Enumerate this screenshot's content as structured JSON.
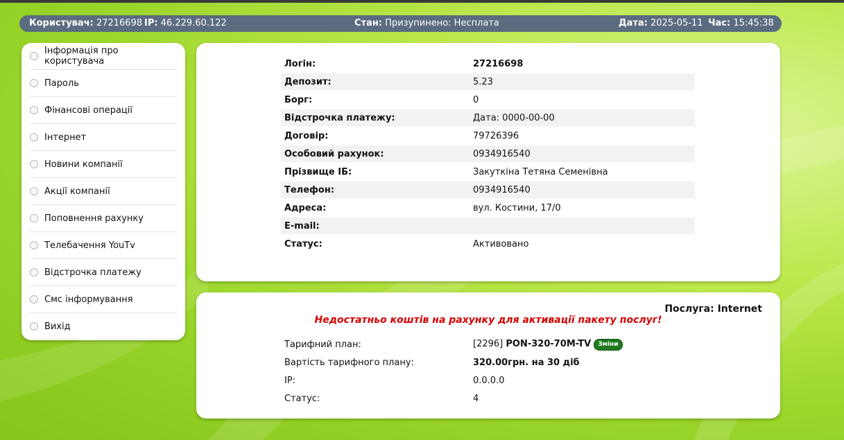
{
  "status_bar": {
    "user_label": "Користувач:",
    "user_value": "27216698",
    "ip_label": "IP:",
    "ip_value": "46.229.60.122",
    "state_label": "Стан:",
    "state_value": "Призупинено: Несплата",
    "date_label": "Дата:",
    "date_value": "2025-05-11",
    "time_label": "Час:",
    "time_value": "15:45:38"
  },
  "sidebar": {
    "items": [
      {
        "label": "Інформація про користувача"
      },
      {
        "label": "Пароль"
      },
      {
        "label": "Фінансові операції"
      },
      {
        "label": "Інтернет"
      },
      {
        "label": "Новини компанії"
      },
      {
        "label": "Акції компанії"
      },
      {
        "label": "Поповнення рахунку"
      },
      {
        "label": "Телебачення YouTv"
      },
      {
        "label": "Відстрочка платежу"
      },
      {
        "label": "Смс інформування"
      },
      {
        "label": "Вихід"
      }
    ]
  },
  "user_info": {
    "rows": [
      {
        "label": "Логін:",
        "value": "27216698"
      },
      {
        "label": "Депозит:",
        "value": "5.23"
      },
      {
        "label": "Борг:",
        "value": "0"
      },
      {
        "label": "Відстрочка платежу:",
        "value": "Дата: 0000-00-00"
      },
      {
        "label": "Договір:",
        "value": "79726396"
      },
      {
        "label": "Особовий рахунок:",
        "value": "0934916540"
      },
      {
        "label": "Прізвище ІБ:",
        "value": "Закуткіна Тетяна Семенівна"
      },
      {
        "label": "Телефон:",
        "value": "0934916540"
      },
      {
        "label": "Адреса:",
        "value": "вул. Костини, 17/0"
      },
      {
        "label": "E-mail:",
        "value": ""
      },
      {
        "label": "Статус:",
        "value": "Активовано"
      }
    ]
  },
  "service": {
    "title": "Послуга: Internet",
    "warning": "Недостатньо коштів на рахунку для активації пакету послуг!",
    "tariff_label": "Тарифний план:",
    "tariff_id": "[2296]",
    "tariff_name": "PON-320-70M-TV",
    "change_label": "Зміни",
    "cost_label": "Вартість тарифного плану:",
    "cost_value": "320.00грн. на 30 діб",
    "ip_label": "IP:",
    "ip_value": "0.0.0.0",
    "status_label": "Статус:",
    "status_value": "4"
  }
}
